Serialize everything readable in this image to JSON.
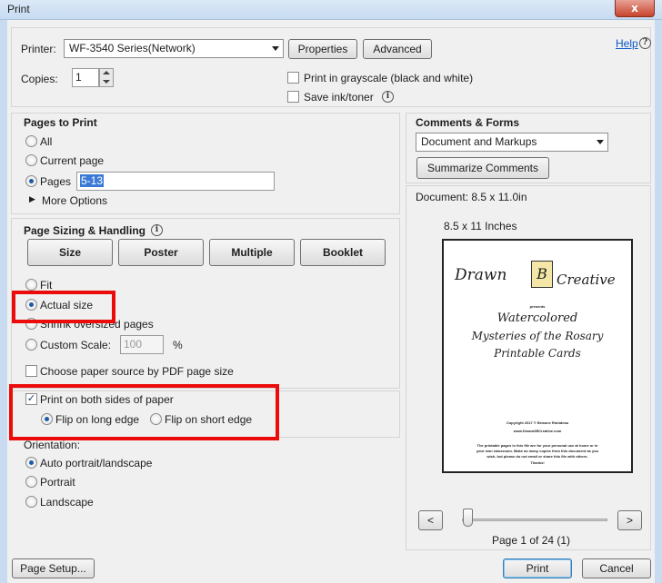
{
  "window": {
    "title": "Print",
    "close_label": "x"
  },
  "printer": {
    "label": "Printer:",
    "selected": "WF-3540 Series(Network)",
    "properties_label": "Properties",
    "advanced_label": "Advanced",
    "help_label": "Help"
  },
  "copies": {
    "label": "Copies:",
    "value": "1"
  },
  "options": {
    "grayscale_label": "Print in grayscale (black and white)",
    "save_ink_label": "Save ink/toner"
  },
  "pages_to_print": {
    "title": "Pages to Print",
    "all_label": "All",
    "current_label": "Current page",
    "pages_label": "Pages",
    "pages_value": "5-13",
    "more_options_label": "More Options"
  },
  "page_sizing": {
    "title": "Page Sizing & Handling",
    "buttons": [
      "Size",
      "Poster",
      "Multiple",
      "Booklet"
    ],
    "fit_label": "Fit",
    "actual_label": "Actual size",
    "shrink_label": "Shrink oversized pages",
    "custom_label": "Custom Scale:",
    "custom_value": "100",
    "percent": "%",
    "paper_source_label": "Choose paper source by PDF page size",
    "both_sides_label": "Print on both sides of paper",
    "flip_long_label": "Flip on long edge",
    "flip_short_label": "Flip on short edge"
  },
  "orientation": {
    "title": "Orientation:",
    "auto_label": "Auto portrait/landscape",
    "portrait_label": "Portrait",
    "landscape_label": "Landscape"
  },
  "comments": {
    "title": "Comments & Forms",
    "selected": "Document and Markups",
    "summarize_label": "Summarize Comments"
  },
  "preview": {
    "document_size": "Document: 8.5 x 11.0in",
    "page_size": "8.5 x 11 Inches",
    "brand_line1": "Drawn",
    "brand_b": "B",
    "brand_line2": "Creative",
    "presents": "presents",
    "doc_title_1": "Watercolored",
    "doc_title_2": "Mysteries of the Rosary",
    "doc_title_3": "Printable Cards",
    "copyright": "Copyright 2017 © Brianne Robideau",
    "website": "www.Drawn2BCreative.com",
    "footer_1": "The printable pages in this file are for your personal use at home or in",
    "footer_2": "your own classroom. Make as many copies from this document as you",
    "footer_3": "wish, but please do not email or share this file with others.",
    "footer_4": "Thanks!",
    "prev_label": "<",
    "next_label": ">",
    "page_indicator": "Page 1 of 24 (1)"
  },
  "footer": {
    "page_setup_label": "Page Setup...",
    "print_label": "Print",
    "cancel_label": "Cancel"
  },
  "colors": {
    "highlight": "#ec0b0b",
    "accent": "#1d5aa7"
  }
}
